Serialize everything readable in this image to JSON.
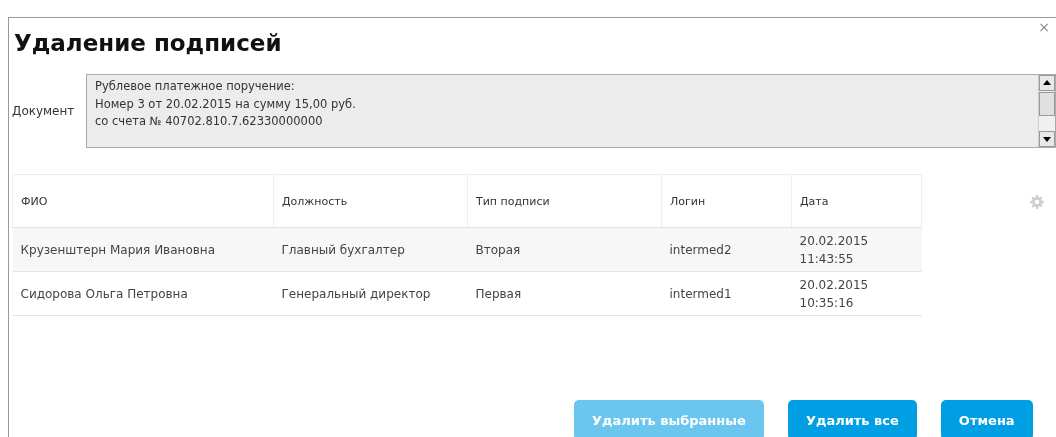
{
  "dialog": {
    "title": "Удаление подписей",
    "close": "×"
  },
  "document": {
    "label": "Документ",
    "lines": [
      "Рублевое платежное поручение:",
      "Номер 3 от 20.02.2015 на сумму 15,00 руб.",
      "со счета № 40702.810.7.62330000000"
    ]
  },
  "table": {
    "columns": [
      "ФИО",
      "Должность",
      "Тип подписи",
      "Логин",
      "Дата"
    ],
    "rows": [
      {
        "cells": [
          "Крузенштерн Мария Ивановна",
          "Главный бухгалтер",
          "Вторая",
          "intermed2",
          "20.02.2015\n11:43:55"
        ]
      },
      {
        "cells": [
          "Сидорова Ольга Петровна",
          "Генеральный директор",
          "Первая",
          "intermed1",
          "20.02.2015\n10:35:16"
        ]
      }
    ]
  },
  "buttons": [
    {
      "label": "Удалить выбранные",
      "disabled": true
    },
    {
      "label": "Удалить все",
      "disabled": false
    },
    {
      "label": "Отмена",
      "disabled": false
    }
  ]
}
